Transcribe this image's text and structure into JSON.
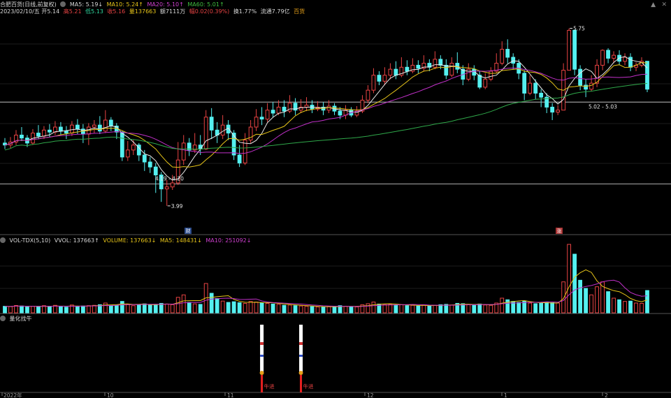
{
  "header": {
    "title": "合肥百货(日线,前复权)",
    "ma5": "MA5: 5.19↓",
    "ma10": "MA10: 5.24↑",
    "ma20": "MA20: 5.10↑",
    "ma60": "MA60: 5.01↑",
    "date_open": "2023/02/10/五 开5.14",
    "high": "高5.21",
    "low": "低5.13",
    "close": "收5.16",
    "vol": "量137663",
    "amount": "额7111万",
    "change": "幅0.02(0.39%)",
    "turnover": "换1.77%",
    "float": "流通7.79亿",
    "tag": "百货"
  },
  "vol_header": {
    "name": "VOL-TDX(5,10)",
    "vvol": "VVOL: 137663↑",
    "volume": "VOLUME: 137663↓",
    "ma5": "MA5: 148431↓",
    "ma10": "MA10: 251092↓"
  },
  "ind_header": {
    "name": "量化找牛"
  },
  "annotations": {
    "max": "5.75",
    "min": "3.99",
    "range_low": "4.19 - 4.20",
    "range_high": "5.02 - 5.03",
    "cai": "财",
    "zhang": "涨",
    "signal": "牛进"
  },
  "controls": {
    "up_arrow": "▲",
    "close_x": "✕"
  },
  "chart_data": {
    "type": "candlestick",
    "x_tick_labels": [
      "2022年",
      "10",
      "11",
      "12",
      "1",
      "2"
    ],
    "y_range": [
      3.8,
      5.9
    ],
    "candles": [
      [
        4.62,
        4.6,
        4.67,
        4.56,
        40
      ],
      [
        4.6,
        4.63,
        4.68,
        4.57,
        38
      ],
      [
        4.63,
        4.7,
        4.75,
        4.6,
        45
      ],
      [
        4.7,
        4.67,
        4.78,
        4.64,
        42
      ],
      [
        4.67,
        4.62,
        4.7,
        4.58,
        36
      ],
      [
        4.62,
        4.72,
        4.76,
        4.6,
        40
      ],
      [
        4.72,
        4.69,
        4.8,
        4.66,
        38
      ],
      [
        4.69,
        4.75,
        4.79,
        4.66,
        44
      ],
      [
        4.75,
        4.73,
        4.81,
        4.68,
        40
      ],
      [
        4.73,
        4.78,
        4.84,
        4.7,
        46
      ],
      [
        4.78,
        4.74,
        4.83,
        4.7,
        38
      ],
      [
        4.74,
        4.72,
        4.79,
        4.66,
        35
      ],
      [
        4.72,
        4.8,
        4.84,
        4.69,
        48
      ],
      [
        4.8,
        4.76,
        4.86,
        4.71,
        40
      ],
      [
        4.76,
        4.71,
        4.81,
        4.62,
        42
      ],
      [
        4.71,
        4.78,
        4.82,
        4.6,
        44
      ],
      [
        4.78,
        4.8,
        4.85,
        4.72,
        46
      ],
      [
        4.8,
        4.74,
        4.89,
        4.71,
        50
      ],
      [
        4.74,
        4.85,
        4.95,
        4.72,
        60
      ],
      [
        4.85,
        4.79,
        4.88,
        4.74,
        44
      ],
      [
        4.79,
        4.73,
        4.82,
        4.66,
        48
      ],
      [
        4.73,
        4.48,
        4.74,
        4.44,
        70
      ],
      [
        4.48,
        4.55,
        4.64,
        4.44,
        52
      ],
      [
        4.55,
        4.6,
        4.65,
        4.5,
        44
      ],
      [
        4.6,
        4.5,
        4.62,
        4.44,
        48
      ],
      [
        4.5,
        4.43,
        4.55,
        4.34,
        55
      ],
      [
        4.43,
        4.38,
        4.48,
        4.32,
        50
      ],
      [
        4.38,
        4.3,
        4.42,
        4.12,
        52
      ],
      [
        4.3,
        4.16,
        4.33,
        4.03,
        58
      ],
      [
        4.16,
        4.18,
        4.25,
        3.99,
        54
      ],
      [
        4.18,
        4.22,
        4.3,
        4.15,
        50
      ],
      [
        4.22,
        4.45,
        4.63,
        4.2,
        95
      ],
      [
        4.45,
        4.62,
        4.7,
        4.4,
        110
      ],
      [
        4.62,
        4.55,
        4.67,
        4.49,
        64
      ],
      [
        4.55,
        4.6,
        4.72,
        4.52,
        55
      ],
      [
        4.6,
        4.56,
        4.7,
        4.5,
        52
      ],
      [
        4.56,
        4.88,
        4.95,
        4.55,
        180
      ],
      [
        4.88,
        4.75,
        4.97,
        4.66,
        120
      ],
      [
        4.75,
        4.7,
        4.83,
        4.62,
        88
      ],
      [
        4.7,
        4.8,
        4.9,
        4.66,
        72
      ],
      [
        4.8,
        4.72,
        4.85,
        4.65,
        64
      ],
      [
        4.72,
        4.5,
        4.75,
        4.45,
        68
      ],
      [
        4.5,
        4.42,
        4.6,
        4.38,
        62
      ],
      [
        4.42,
        4.65,
        4.72,
        4.4,
        58
      ],
      [
        4.65,
        4.78,
        4.85,
        4.62,
        70
      ],
      [
        4.78,
        4.88,
        4.96,
        4.74,
        66
      ],
      [
        4.88,
        4.86,
        4.98,
        4.8,
        60
      ],
      [
        4.86,
        4.95,
        5.02,
        4.83,
        58
      ],
      [
        4.95,
        4.92,
        5.03,
        4.88,
        54
      ],
      [
        4.92,
        4.98,
        5.05,
        4.9,
        52
      ],
      [
        4.98,
        4.94,
        5.05,
        4.88,
        46
      ],
      [
        4.94,
        5.02,
        5.1,
        4.92,
        48
      ],
      [
        5.02,
        4.95,
        5.07,
        4.9,
        44
      ],
      [
        4.95,
        4.98,
        5.06,
        4.92,
        42
      ],
      [
        4.98,
        5.0,
        5.08,
        4.94,
        40
      ],
      [
        5.0,
        4.96,
        5.05,
        4.92,
        38
      ],
      [
        4.96,
        4.98,
        5.04,
        4.94,
        36
      ],
      [
        4.98,
        4.95,
        5.03,
        4.9,
        35
      ],
      [
        4.95,
        4.99,
        5.05,
        4.92,
        38
      ],
      [
        4.99,
        4.94,
        5.02,
        4.9,
        40
      ],
      [
        4.94,
        4.9,
        4.98,
        4.86,
        44
      ],
      [
        4.9,
        4.95,
        5.0,
        4.86,
        40
      ],
      [
        4.95,
        4.9,
        4.98,
        4.88,
        38
      ],
      [
        4.9,
        4.94,
        4.99,
        4.88,
        36
      ],
      [
        4.94,
        5.05,
        5.1,
        4.92,
        50
      ],
      [
        5.05,
        5.15,
        5.2,
        5.02,
        56
      ],
      [
        5.15,
        5.3,
        5.37,
        5.12,
        66
      ],
      [
        5.3,
        5.24,
        5.34,
        5.2,
        54
      ],
      [
        5.24,
        5.3,
        5.38,
        5.2,
        50
      ],
      [
        5.3,
        5.36,
        5.42,
        5.26,
        52
      ],
      [
        5.36,
        5.3,
        5.44,
        5.26,
        46
      ],
      [
        5.3,
        5.38,
        5.48,
        5.28,
        50
      ],
      [
        5.38,
        5.34,
        5.45,
        5.3,
        44
      ],
      [
        5.34,
        5.4,
        5.47,
        5.32,
        46
      ],
      [
        5.4,
        5.37,
        5.45,
        5.32,
        42
      ],
      [
        5.37,
        5.42,
        5.5,
        5.34,
        48
      ],
      [
        5.42,
        5.38,
        5.46,
        5.34,
        42
      ],
      [
        5.38,
        5.46,
        5.54,
        5.36,
        46
      ],
      [
        5.46,
        5.4,
        5.5,
        5.36,
        50
      ],
      [
        5.4,
        5.3,
        5.46,
        5.26,
        52
      ],
      [
        5.3,
        5.42,
        5.48,
        5.28,
        48
      ],
      [
        5.42,
        5.36,
        5.53,
        5.32,
        58
      ],
      [
        5.36,
        5.26,
        5.4,
        5.2,
        56
      ],
      [
        5.26,
        5.36,
        5.42,
        5.24,
        50
      ],
      [
        5.36,
        5.3,
        5.4,
        5.25,
        46
      ],
      [
        5.3,
        5.18,
        5.34,
        5.16,
        54
      ],
      [
        5.18,
        5.26,
        5.32,
        5.16,
        48
      ],
      [
        5.26,
        5.34,
        5.38,
        5.24,
        46
      ],
      [
        5.34,
        5.42,
        5.52,
        5.32,
        60
      ],
      [
        5.42,
        5.56,
        5.64,
        5.4,
        90
      ],
      [
        5.56,
        5.48,
        5.66,
        5.42,
        80
      ],
      [
        5.48,
        5.42,
        5.52,
        5.36,
        70
      ],
      [
        5.42,
        5.32,
        5.46,
        5.26,
        64
      ],
      [
        5.32,
        5.12,
        5.35,
        5.05,
        72
      ],
      [
        5.12,
        5.22,
        5.3,
        5.1,
        60
      ],
      [
        5.22,
        5.12,
        5.26,
        5.06,
        56
      ],
      [
        5.12,
        5.08,
        5.16,
        4.98,
        58
      ],
      [
        5.08,
        4.98,
        5.12,
        4.92,
        64
      ],
      [
        4.98,
        4.93,
        5.02,
        4.85,
        62
      ],
      [
        4.93,
        4.95,
        5.0,
        4.9,
        60
      ],
      [
        4.95,
        5.35,
        5.42,
        4.95,
        190
      ],
      [
        5.35,
        5.75,
        5.77,
        5.35,
        420
      ],
      [
        5.75,
        5.36,
        5.76,
        5.3,
        360
      ],
      [
        5.36,
        5.2,
        5.4,
        5.15,
        200
      ],
      [
        5.2,
        5.16,
        5.26,
        5.08,
        150
      ],
      [
        5.16,
        5.22,
        5.3,
        5.14,
        110
      ],
      [
        5.22,
        5.4,
        5.46,
        5.18,
        160
      ],
      [
        5.4,
        5.55,
        5.56,
        5.35,
        190
      ],
      [
        5.55,
        5.47,
        5.57,
        5.42,
        130
      ],
      [
        5.47,
        5.5,
        5.54,
        5.42,
        90
      ],
      [
        5.5,
        5.44,
        5.55,
        5.4,
        80
      ],
      [
        5.44,
        5.48,
        5.52,
        5.4,
        70
      ],
      [
        5.48,
        5.38,
        5.52,
        5.34,
        72
      ],
      [
        5.38,
        5.4,
        5.43,
        5.34,
        60
      ],
      [
        5.4,
        5.44,
        5.48,
        5.38,
        58
      ],
      [
        5.44,
        5.16,
        5.21,
        5.13,
        137
      ]
    ],
    "volume_scale_max": 420,
    "price_lines": [
      4.21,
      5.03
    ],
    "signal_positions": [
      46,
      53,
      160
    ]
  }
}
